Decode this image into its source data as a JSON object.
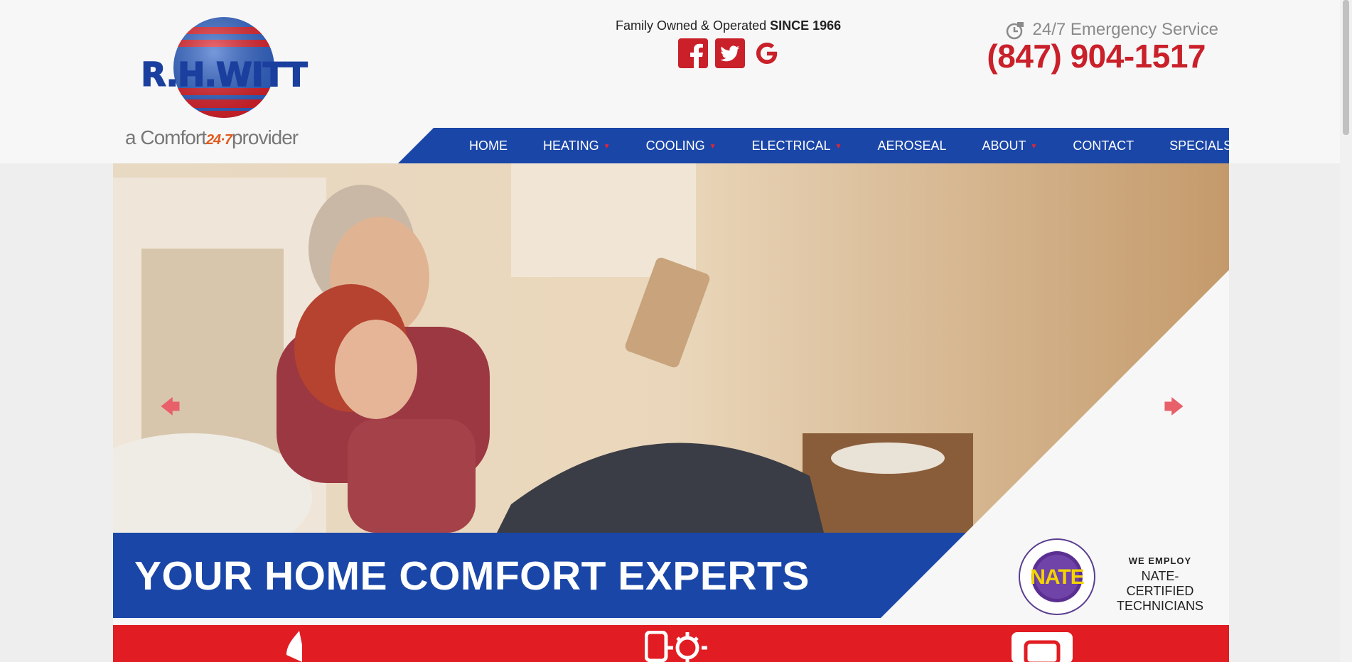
{
  "logo": {
    "name": "R.H.WITT",
    "tagline_prefix": "a Comfort",
    "tagline_number": "24·7",
    "tagline_suffix": "provider"
  },
  "header": {
    "family_text": "Family Owned & Operated",
    "family_since": "SINCE 1966",
    "social": [
      {
        "icon": "facebook-icon",
        "label": "Facebook"
      },
      {
        "icon": "twitter-icon",
        "label": "Twitter"
      },
      {
        "icon": "google-icon",
        "label": "Google"
      }
    ],
    "emergency_text": "24/7 Emergency Service",
    "phone": "(847) 904-1517"
  },
  "nav": {
    "items": [
      {
        "label": "HOME",
        "dropdown": false
      },
      {
        "label": "HEATING",
        "dropdown": true
      },
      {
        "label": "COOLING",
        "dropdown": true
      },
      {
        "label": "ELECTRICAL",
        "dropdown": true
      },
      {
        "label": "AEROSEAL",
        "dropdown": false
      },
      {
        "label": "ABOUT",
        "dropdown": true
      },
      {
        "label": "CONTACT",
        "dropdown": false
      },
      {
        "label": "SPECIALS",
        "dropdown": false
      }
    ]
  },
  "hero": {
    "tagline": "YOUR HOME COMFORT EXPERTS",
    "prev_arrow": "🡄",
    "next_arrow": "🡆",
    "nate": {
      "badge_text": "NATE",
      "line1": "WE EMPLOY",
      "line2": "NATE-CERTIFIED",
      "line3": "TECHNICIANS"
    }
  },
  "colors": {
    "brand_blue": "#1a46a8",
    "brand_red": "#e11c22",
    "phone_red": "#c9202a"
  }
}
